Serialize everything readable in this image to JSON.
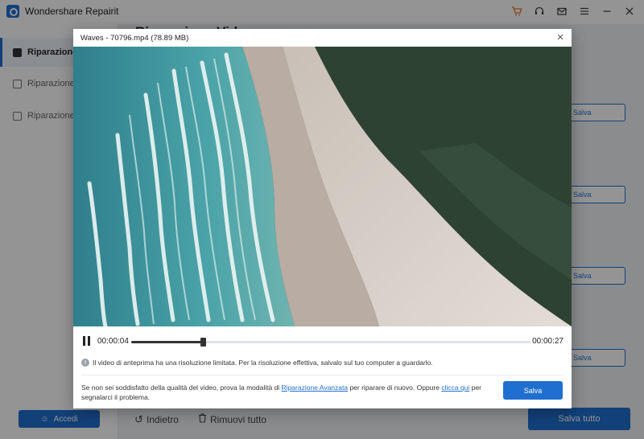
{
  "app": {
    "title": "Wondershare Repairit"
  },
  "titlebar": {
    "icons": [
      "cart-icon",
      "headset-icon",
      "mail-icon",
      "menu-icon",
      "minimize-icon",
      "close-icon"
    ],
    "accent": "#e8742a"
  },
  "sidebar": {
    "items": [
      {
        "label": "Riparazione Video",
        "icon": "video-icon",
        "active": true
      },
      {
        "label": "Riparazione Foto",
        "icon": "photo-icon",
        "active": false
      },
      {
        "label": "Riparazione File",
        "icon": "file-icon",
        "active": false
      }
    ],
    "login_label": "Accedi"
  },
  "main": {
    "heading": "Riparazione Video",
    "row_save_label": "Salva"
  },
  "bottom": {
    "back_label": "Indietro",
    "remove_all_label": "Rimuovi tutto",
    "save_all_label": "Salva tutto"
  },
  "modal": {
    "title": "Waves - 70796.mp4 (78.89  MB)",
    "player": {
      "current_time": "00:00:04",
      "total_time": "00:00:27",
      "progress": 0.18
    },
    "info_note": "Il video di anteprima ha una risoluzione limitata. Per la risoluzione effettiva, salvalo sul tuo computer a guardarlo.",
    "help": {
      "part1": "Se non sei soddisfatto della qualità del video, prova la modalità di ",
      "link1": "Riparazione Avanzata",
      "part2": " per riparare di nuovo. Oppure ",
      "link2": "clicca qui",
      "part3": " per segnalarci il problema."
    },
    "save_label": "Salva"
  },
  "colors": {
    "primary": "#1f6fd0",
    "sea": "#3a8f9a",
    "sand": "#d8cfc6",
    "forest": "#2a3a2c"
  }
}
